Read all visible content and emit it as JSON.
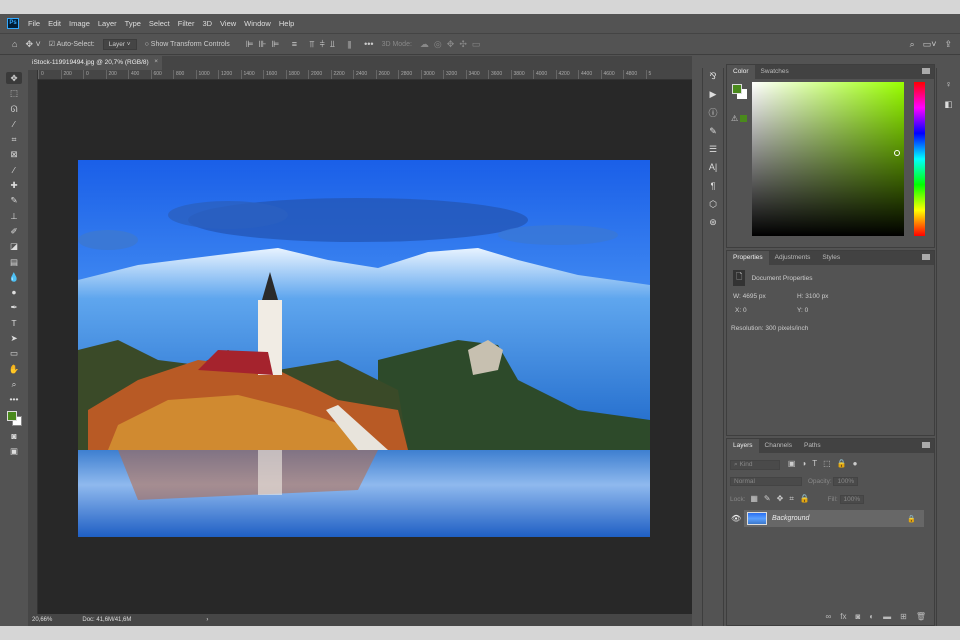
{
  "app": {
    "logo": "Ps"
  },
  "menu": [
    "File",
    "Edit",
    "Image",
    "Layer",
    "Type",
    "Select",
    "Filter",
    "3D",
    "View",
    "Window",
    "Help"
  ],
  "options": {
    "auto_select_label": "Auto-Select:",
    "auto_select_checked": true,
    "target": "Layer",
    "show_transform_label": "Show Transform Controls",
    "mode_3d": "3D Mode:"
  },
  "document": {
    "tab_title": "iStock-119919494.jpg @ 20,7% (RGB/8)"
  },
  "ruler": [
    "0",
    "200",
    "0",
    "200",
    "400",
    "600",
    "800",
    "1000",
    "1200",
    "1400",
    "1600",
    "1800",
    "2000",
    "2200",
    "2400",
    "2600",
    "2800",
    "3000",
    "3200",
    "3400",
    "3600",
    "3800",
    "4000",
    "4200",
    "4400",
    "4600",
    "4800",
    "5"
  ],
  "status": {
    "zoom": "20,66%",
    "doc": "Doc: 41,6M/41,6M"
  },
  "color_panel": {
    "tabs": [
      "Color",
      "Swatches"
    ],
    "foreground": "#4a8a1c",
    "background": "#ffffff",
    "hue": "#99ff00"
  },
  "properties": {
    "tabs": [
      "Properties",
      "Adjustments",
      "Styles"
    ],
    "title": "Document Properties",
    "w": "W:  4695 px",
    "h": "H:  3100 px",
    "x": "X:  0",
    "y": "Y:  0",
    "resolution": "Resolution:  300 pixels/inch"
  },
  "layers": {
    "tabs": [
      "Layers",
      "Channels",
      "Paths"
    ],
    "kind": "Kind",
    "blend": "Normal",
    "opacity_label": "Opacity:",
    "opacity": "100%",
    "lock_label": "Lock:",
    "fill_label": "Fill:",
    "fill": "100%",
    "items": [
      {
        "name": "Background",
        "visible": true,
        "locked": true
      }
    ]
  }
}
